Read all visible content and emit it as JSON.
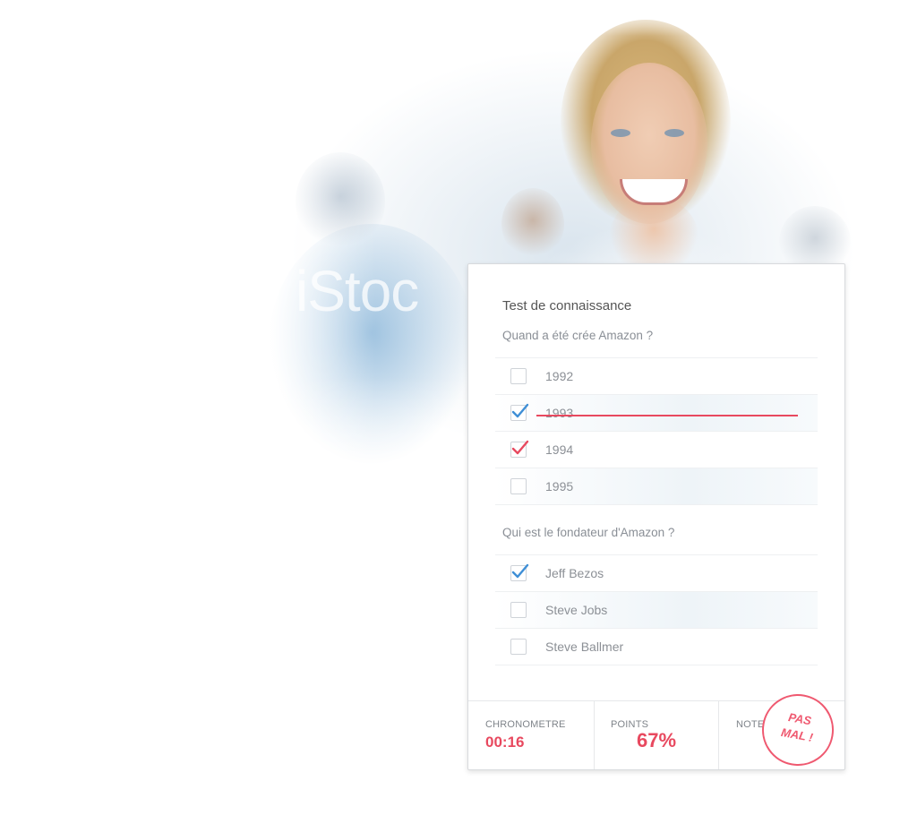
{
  "background": {
    "watermark": "iStoc"
  },
  "card": {
    "title": "Test de connaissance",
    "questions": [
      {
        "label": "Quand a été crée Amazon ?",
        "options": [
          {
            "label": "1992",
            "state": "unchecked"
          },
          {
            "label": "1993",
            "state": "checked-wrong"
          },
          {
            "label": "1994",
            "state": "correct-answer"
          },
          {
            "label": "1995",
            "state": "unchecked"
          }
        ]
      },
      {
        "label": "Qui est le fondateur d'Amazon ?",
        "options": [
          {
            "label": "Jeff Bezos",
            "state": "checked"
          },
          {
            "label": "Steve Jobs",
            "state": "unchecked"
          },
          {
            "label": "Steve Ballmer",
            "state": "unchecked"
          }
        ]
      }
    ],
    "footer": {
      "timer_label": "CHRONOMETRE",
      "timer_value": "00:16",
      "points_label": "POINTS",
      "points_value": "67%",
      "notes_label": "NOTES",
      "stamp_line1": "PAS",
      "stamp_line2": "MAL !"
    }
  },
  "colors": {
    "accent_red": "#e8495f",
    "check_blue": "#3f8fd6",
    "text_gray": "#8c9096"
  }
}
